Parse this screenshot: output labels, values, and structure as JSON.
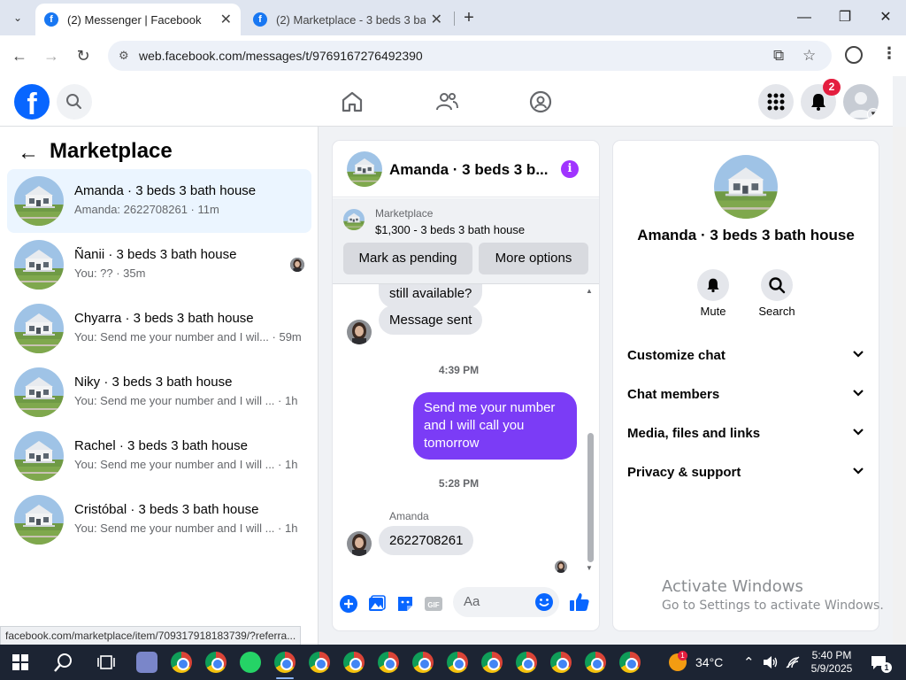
{
  "browser": {
    "tabs": [
      {
        "title": "(2) Messenger | Facebook",
        "active": true
      },
      {
        "title": "(2) Marketplace - 3 beds 3 bath house",
        "active": false
      }
    ],
    "url": "web.facebook.com/messages/t/9769167276492390",
    "status_url": "facebook.com/marketplace/item/709317918183739/?referra..."
  },
  "fb_header": {
    "notification_count": "2",
    "logo_letter": "f"
  },
  "left_panel": {
    "title": "Marketplace",
    "threads": [
      {
        "name": "Amanda · 3 beds 3 bath house",
        "preview": "Amanda: 2622708261 · 11m",
        "active": true
      },
      {
        "name": "Ñanii · 3 beds 3 bath house",
        "preview": "You: ?? · 35m",
        "active": false
      },
      {
        "name": "Chyarra · 3 beds 3 bath house",
        "preview": "You: Send me your number and I wil... · 59m",
        "active": false
      },
      {
        "name": "Niky · 3 beds 3 bath house",
        "preview": "You: Send me your number and I will ... · 1h",
        "active": false
      },
      {
        "name": "Rachel · 3 beds 3 bath house",
        "preview": "You: Send me your number and I will ... · 1h",
        "active": false
      },
      {
        "name": "Cristóbal · 3 beds 3 bath house",
        "preview": "You: Send me your number and I will ... · 1h",
        "active": false
      }
    ]
  },
  "chat": {
    "title": "Amanda · 3 beds 3 b...",
    "marketplace_label": "Marketplace",
    "listing": "$1,300 - 3 beds 3 bath house",
    "mark_pending": "Mark as pending",
    "more_options": "More options",
    "messages": {
      "partial": "still available?",
      "sent_notice": "Message sent",
      "time1": "4:39 PM",
      "outgoing": "Send me your number and I will call you tomorrow",
      "time2": "5:28 PM",
      "sender": "Amanda",
      "incoming": "2622708261"
    },
    "composer_placeholder": "Aa"
  },
  "right_panel": {
    "name": "Amanda · 3 beds 3 bath house",
    "actions": [
      {
        "label": "Mute",
        "icon": "bell-icon"
      },
      {
        "label": "Search",
        "icon": "search-icon"
      }
    ],
    "sections": [
      "Customize chat",
      "Chat members",
      "Media, files and links",
      "Privacy & support"
    ]
  },
  "watermark": {
    "line1": "Activate Windows",
    "line2": "Go to Settings to activate Windows."
  },
  "taskbar": {
    "temperature": "34°C",
    "weather_badge": "1",
    "time": "5:40 PM",
    "date": "5/9/2025",
    "notification_count": "1"
  },
  "colors": {
    "fb_blue": "#0866ff",
    "outgoing_bubble": "#7b3cf6",
    "active_thread": "#ebf5ff",
    "badge_red": "#e41e3f"
  }
}
